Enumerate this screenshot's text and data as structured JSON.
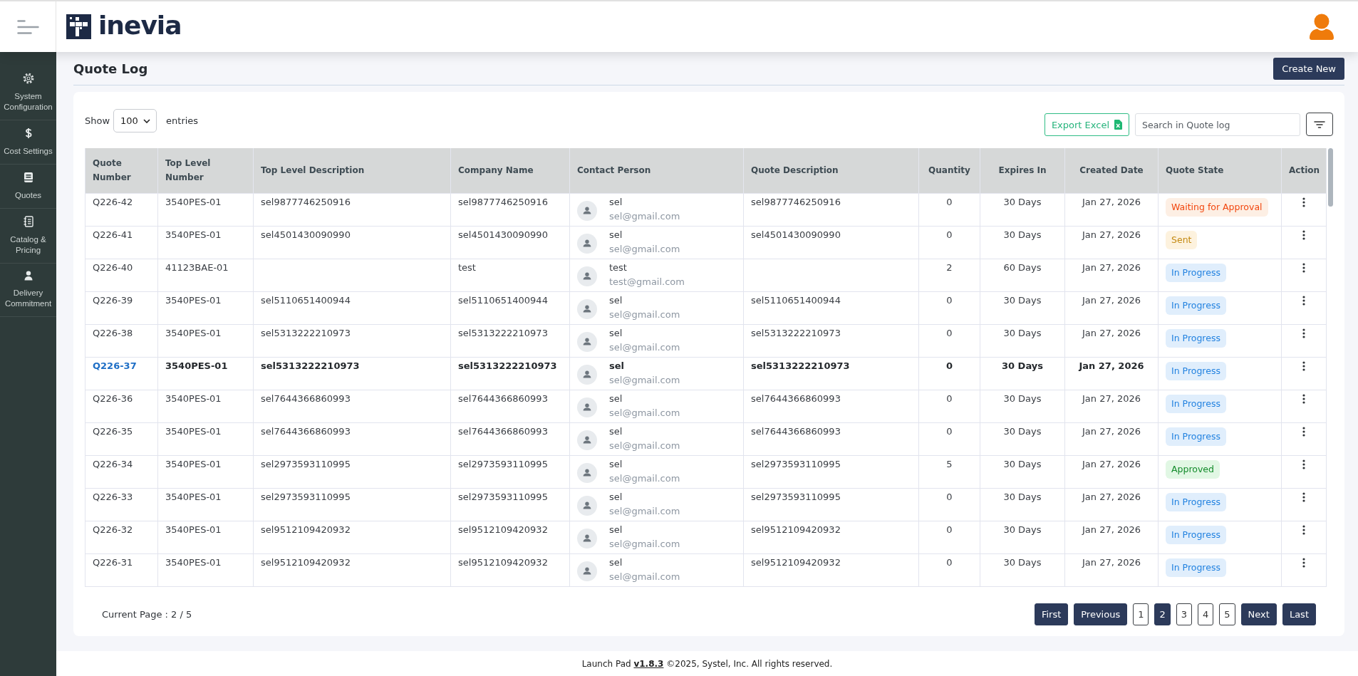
{
  "header": {
    "logo_text": "inevia"
  },
  "sidebar": {
    "items": [
      {
        "label": "System Configuration"
      },
      {
        "label": "Cost Settings"
      },
      {
        "label": "Quotes"
      },
      {
        "label": "Catalog & Pricing"
      },
      {
        "label": "Delivery Commitment"
      }
    ]
  },
  "page": {
    "title": "Quote Log",
    "create_button": "Create New"
  },
  "toolbar": {
    "show_label": "Show",
    "page_size": "100",
    "entries_label": "entries",
    "export_button": "Export Excel",
    "search": {
      "placeholder": "Search in Quote log"
    }
  },
  "table": {
    "columns": [
      "Quote Number",
      "Top Level Number",
      "Top Level Description",
      "Company Name",
      "Contact Person",
      "Quote Description",
      "Quantity",
      "Expires In",
      "Created Date",
      "Quote State",
      "Action"
    ],
    "rows": [
      {
        "quote_number": "Q226-42",
        "top_level_number": "3540PES-01",
        "top_level_description": "sel9877746250916",
        "company_name": "sel9877746250916",
        "contact": {
          "name": "sel",
          "email": "sel@gmail.com"
        },
        "quote_description": "sel9877746250916",
        "quantity": "0",
        "expires_in": "30 Days",
        "created_date": "Jan 27, 2026",
        "state": {
          "label": "Waiting for Approval",
          "kind": "waiting"
        },
        "selected": false
      },
      {
        "quote_number": "Q226-41",
        "top_level_number": "3540PES-01",
        "top_level_description": "sel4501430090990",
        "company_name": "sel4501430090990",
        "contact": {
          "name": "sel",
          "email": "sel@gmail.com"
        },
        "quote_description": "sel4501430090990",
        "quantity": "0",
        "expires_in": "30 Days",
        "created_date": "Jan 27, 2026",
        "state": {
          "label": "Sent",
          "kind": "sent"
        },
        "selected": false
      },
      {
        "quote_number": "Q226-40",
        "top_level_number": "41123BAE-01",
        "company_name": "test",
        "contact": {
          "name": "test",
          "email": "test@gmail.com"
        },
        "quantity": "2",
        "expires_in": "60 Days",
        "created_date": "Jan 27, 2026",
        "state": {
          "label": "In Progress",
          "kind": "progress"
        },
        "selected": false
      },
      {
        "quote_number": "Q226-39",
        "top_level_number": "3540PES-01",
        "top_level_description": "sel5110651400944",
        "company_name": "sel5110651400944",
        "contact": {
          "name": "sel",
          "email": "sel@gmail.com"
        },
        "quote_description": "sel5110651400944",
        "quantity": "0",
        "expires_in": "30 Days",
        "created_date": "Jan 27, 2026",
        "state": {
          "label": "In Progress",
          "kind": "progress"
        },
        "selected": false
      },
      {
        "quote_number": "Q226-38",
        "top_level_number": "3540PES-01",
        "top_level_description": "sel5313222210973",
        "company_name": "sel5313222210973",
        "contact": {
          "name": "sel",
          "email": "sel@gmail.com"
        },
        "quote_description": "sel5313222210973",
        "quantity": "0",
        "expires_in": "30 Days",
        "created_date": "Jan 27, 2026",
        "state": {
          "label": "In Progress",
          "kind": "progress"
        },
        "selected": false
      },
      {
        "quote_number": "Q226-37",
        "top_level_number": "3540PES-01",
        "top_level_description": "sel5313222210973",
        "company_name": "sel5313222210973",
        "contact": {
          "name": "sel",
          "email": "sel@gmail.com"
        },
        "quote_description": "sel5313222210973",
        "quantity": "0",
        "expires_in": "30 Days",
        "created_date": "Jan 27, 2026",
        "state": {
          "label": "In Progress",
          "kind": "progress"
        },
        "selected": true
      },
      {
        "quote_number": "Q226-36",
        "top_level_number": "3540PES-01",
        "top_level_description": "sel7644366860993",
        "company_name": "sel7644366860993",
        "contact": {
          "name": "sel",
          "email": "sel@gmail.com"
        },
        "quote_description": "sel7644366860993",
        "quantity": "0",
        "expires_in": "30 Days",
        "created_date": "Jan 27, 2026",
        "state": {
          "label": "In Progress",
          "kind": "progress"
        },
        "selected": false
      },
      {
        "quote_number": "Q226-35",
        "top_level_number": "3540PES-01",
        "top_level_description": "sel7644366860993",
        "company_name": "sel7644366860993",
        "contact": {
          "name": "sel",
          "email": "sel@gmail.com"
        },
        "quote_description": "sel7644366860993",
        "quantity": "0",
        "expires_in": "30 Days",
        "created_date": "Jan 27, 2026",
        "state": {
          "label": "In Progress",
          "kind": "progress"
        },
        "selected": false
      },
      {
        "quote_number": "Q226-34",
        "top_level_number": "3540PES-01",
        "top_level_description": "sel2973593110995",
        "company_name": "sel2973593110995",
        "contact": {
          "name": "sel",
          "email": "sel@gmail.com"
        },
        "quote_description": "sel2973593110995",
        "quantity": "5",
        "expires_in": "30 Days",
        "created_date": "Jan 27, 2026",
        "state": {
          "label": "Approved",
          "kind": "approved"
        },
        "selected": false
      },
      {
        "quote_number": "Q226-33",
        "top_level_number": "3540PES-01",
        "top_level_description": "sel2973593110995",
        "company_name": "sel2973593110995",
        "contact": {
          "name": "sel",
          "email": "sel@gmail.com"
        },
        "quote_description": "sel2973593110995",
        "quantity": "0",
        "expires_in": "30 Days",
        "created_date": "Jan 27, 2026",
        "state": {
          "label": "In Progress",
          "kind": "progress"
        },
        "selected": false
      },
      {
        "quote_number": "Q226-32",
        "top_level_number": "3540PES-01",
        "top_level_description": "sel9512109420932",
        "company_name": "sel9512109420932",
        "contact": {
          "name": "sel",
          "email": "sel@gmail.com"
        },
        "quote_description": "sel9512109420932",
        "quantity": "0",
        "expires_in": "30 Days",
        "created_date": "Jan 27, 2026",
        "state": {
          "label": "In Progress",
          "kind": "progress"
        },
        "selected": false
      },
      {
        "quote_number": "Q226-31",
        "top_level_number": "3540PES-01",
        "top_level_description": "sel9512109420932",
        "company_name": "sel9512109420932",
        "contact": {
          "name": "sel",
          "email": "sel@gmail.com"
        },
        "quote_description": "sel9512109420932",
        "quantity": "0",
        "expires_in": "30 Days",
        "created_date": "Jan 27, 2026",
        "state": {
          "label": "In Progress",
          "kind": "progress"
        },
        "selected": false
      }
    ]
  },
  "pagination": {
    "current_page": "Current Page : 2 / 5",
    "first": "First",
    "previous": "Previous",
    "pages": [
      {
        "label": "1",
        "selected": false
      },
      {
        "label": "2",
        "selected": true
      },
      {
        "label": "3",
        "selected": false
      },
      {
        "label": "4",
        "selected": false
      },
      {
        "label": "5",
        "selected": false
      }
    ],
    "next": "Next",
    "last": "Last"
  },
  "footer": {
    "prefix": "Launch Pad",
    "version": "v1.8.3",
    "suffix": "©2025, Systel, Inc. All rights reserved."
  }
}
